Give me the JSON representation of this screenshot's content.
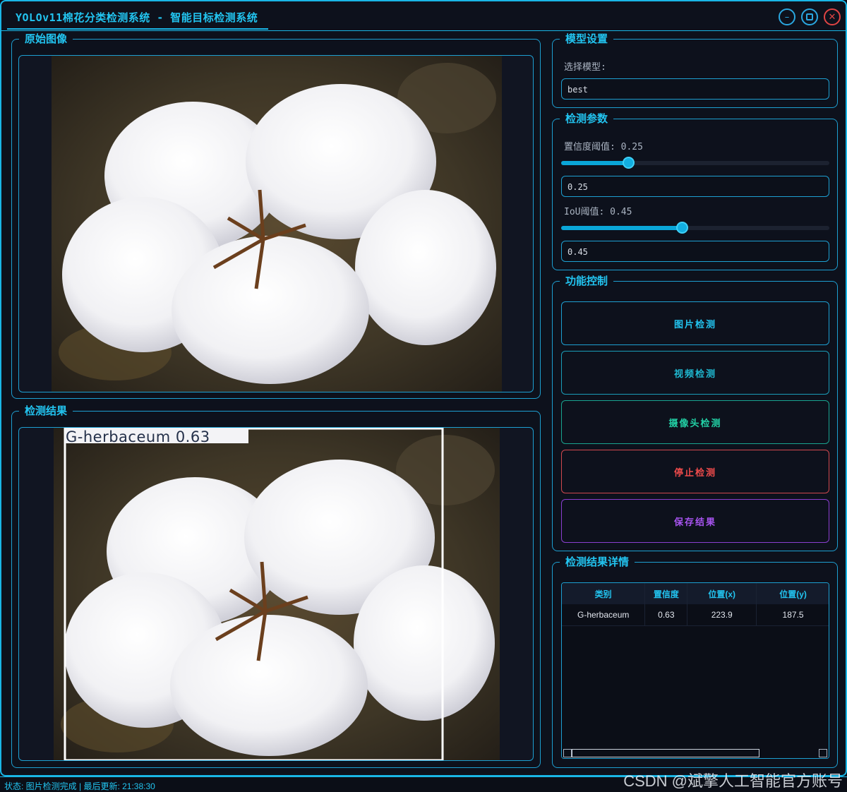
{
  "window": {
    "title": "YOLOv11棉花分类检测系统 - 智能目标检测系统",
    "min_symbol": "–",
    "close_symbol": "✕"
  },
  "original_panel": {
    "title": "原始图像"
  },
  "result_panel": {
    "title": "检测结果",
    "detection_label": "G-herbaceum 0.63"
  },
  "model_settings": {
    "title": "模型设置",
    "select_label": "选择模型:",
    "selected_model": "best"
  },
  "detection_params": {
    "title": "检测参数",
    "confidence_label": "置信度阈值: 0.25",
    "confidence_value": "0.25",
    "confidence_level": 0.25,
    "iou_label": "IoU阈值: 0.45",
    "iou_value": "0.45",
    "iou_level": 0.45
  },
  "controls": {
    "title": "功能控制",
    "image_detect": "图片检测",
    "video_detect": "视频检测",
    "camera_detect": "摄像头检测",
    "stop_detect": "停止检测",
    "save_result": "保存结果"
  },
  "results_table": {
    "title": "检测结果详情",
    "headers": [
      "类别",
      "置信度",
      "位置(x)",
      "位置(y)"
    ],
    "rows": [
      [
        "G-herbaceum",
        "0.63",
        "223.9",
        "187.5"
      ]
    ]
  },
  "status": {
    "text": "状态: 图片检测完成 | 最后更新: 21:38:30"
  },
  "watermark": "CSDN @斌擎人工智能官方账号",
  "colors": {
    "accent": "#22c4f0",
    "stop": "#ef4b4b",
    "camera": "#22d0a5",
    "save": "#a754f0"
  }
}
